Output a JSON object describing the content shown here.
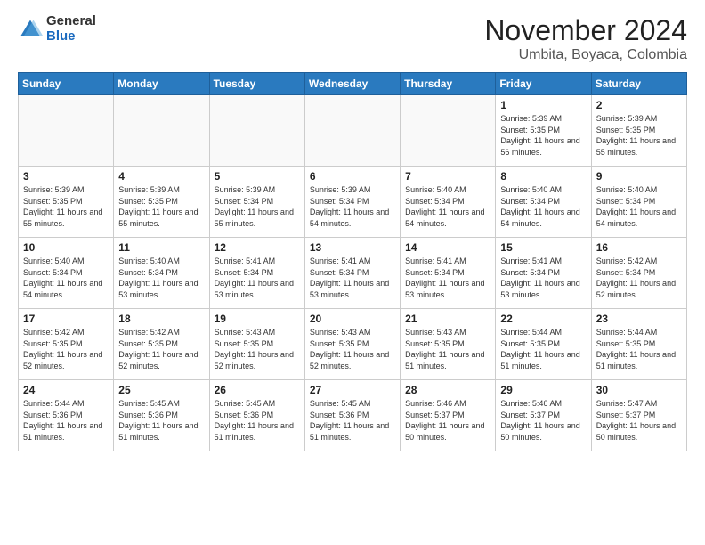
{
  "header": {
    "logo": {
      "general": "General",
      "blue": "Blue"
    },
    "month": "November 2024",
    "location": "Umbita, Boyaca, Colombia"
  },
  "weekdays": [
    "Sunday",
    "Monday",
    "Tuesday",
    "Wednesday",
    "Thursday",
    "Friday",
    "Saturday"
  ],
  "weeks": [
    [
      {
        "day": "",
        "info": ""
      },
      {
        "day": "",
        "info": ""
      },
      {
        "day": "",
        "info": ""
      },
      {
        "day": "",
        "info": ""
      },
      {
        "day": "",
        "info": ""
      },
      {
        "day": "1",
        "info": "Sunrise: 5:39 AM\nSunset: 5:35 PM\nDaylight: 11 hours and 56 minutes."
      },
      {
        "day": "2",
        "info": "Sunrise: 5:39 AM\nSunset: 5:35 PM\nDaylight: 11 hours and 55 minutes."
      }
    ],
    [
      {
        "day": "3",
        "info": "Sunrise: 5:39 AM\nSunset: 5:35 PM\nDaylight: 11 hours and 55 minutes."
      },
      {
        "day": "4",
        "info": "Sunrise: 5:39 AM\nSunset: 5:35 PM\nDaylight: 11 hours and 55 minutes."
      },
      {
        "day": "5",
        "info": "Sunrise: 5:39 AM\nSunset: 5:34 PM\nDaylight: 11 hours and 55 minutes."
      },
      {
        "day": "6",
        "info": "Sunrise: 5:39 AM\nSunset: 5:34 PM\nDaylight: 11 hours and 54 minutes."
      },
      {
        "day": "7",
        "info": "Sunrise: 5:40 AM\nSunset: 5:34 PM\nDaylight: 11 hours and 54 minutes."
      },
      {
        "day": "8",
        "info": "Sunrise: 5:40 AM\nSunset: 5:34 PM\nDaylight: 11 hours and 54 minutes."
      },
      {
        "day": "9",
        "info": "Sunrise: 5:40 AM\nSunset: 5:34 PM\nDaylight: 11 hours and 54 minutes."
      }
    ],
    [
      {
        "day": "10",
        "info": "Sunrise: 5:40 AM\nSunset: 5:34 PM\nDaylight: 11 hours and 54 minutes."
      },
      {
        "day": "11",
        "info": "Sunrise: 5:40 AM\nSunset: 5:34 PM\nDaylight: 11 hours and 53 minutes."
      },
      {
        "day": "12",
        "info": "Sunrise: 5:41 AM\nSunset: 5:34 PM\nDaylight: 11 hours and 53 minutes."
      },
      {
        "day": "13",
        "info": "Sunrise: 5:41 AM\nSunset: 5:34 PM\nDaylight: 11 hours and 53 minutes."
      },
      {
        "day": "14",
        "info": "Sunrise: 5:41 AM\nSunset: 5:34 PM\nDaylight: 11 hours and 53 minutes."
      },
      {
        "day": "15",
        "info": "Sunrise: 5:41 AM\nSunset: 5:34 PM\nDaylight: 11 hours and 53 minutes."
      },
      {
        "day": "16",
        "info": "Sunrise: 5:42 AM\nSunset: 5:34 PM\nDaylight: 11 hours and 52 minutes."
      }
    ],
    [
      {
        "day": "17",
        "info": "Sunrise: 5:42 AM\nSunset: 5:35 PM\nDaylight: 11 hours and 52 minutes."
      },
      {
        "day": "18",
        "info": "Sunrise: 5:42 AM\nSunset: 5:35 PM\nDaylight: 11 hours and 52 minutes."
      },
      {
        "day": "19",
        "info": "Sunrise: 5:43 AM\nSunset: 5:35 PM\nDaylight: 11 hours and 52 minutes."
      },
      {
        "day": "20",
        "info": "Sunrise: 5:43 AM\nSunset: 5:35 PM\nDaylight: 11 hours and 52 minutes."
      },
      {
        "day": "21",
        "info": "Sunrise: 5:43 AM\nSunset: 5:35 PM\nDaylight: 11 hours and 51 minutes."
      },
      {
        "day": "22",
        "info": "Sunrise: 5:44 AM\nSunset: 5:35 PM\nDaylight: 11 hours and 51 minutes."
      },
      {
        "day": "23",
        "info": "Sunrise: 5:44 AM\nSunset: 5:35 PM\nDaylight: 11 hours and 51 minutes."
      }
    ],
    [
      {
        "day": "24",
        "info": "Sunrise: 5:44 AM\nSunset: 5:36 PM\nDaylight: 11 hours and 51 minutes."
      },
      {
        "day": "25",
        "info": "Sunrise: 5:45 AM\nSunset: 5:36 PM\nDaylight: 11 hours and 51 minutes."
      },
      {
        "day": "26",
        "info": "Sunrise: 5:45 AM\nSunset: 5:36 PM\nDaylight: 11 hours and 51 minutes."
      },
      {
        "day": "27",
        "info": "Sunrise: 5:45 AM\nSunset: 5:36 PM\nDaylight: 11 hours and 51 minutes."
      },
      {
        "day": "28",
        "info": "Sunrise: 5:46 AM\nSunset: 5:37 PM\nDaylight: 11 hours and 50 minutes."
      },
      {
        "day": "29",
        "info": "Sunrise: 5:46 AM\nSunset: 5:37 PM\nDaylight: 11 hours and 50 minutes."
      },
      {
        "day": "30",
        "info": "Sunrise: 5:47 AM\nSunset: 5:37 PM\nDaylight: 11 hours and 50 minutes."
      }
    ]
  ]
}
